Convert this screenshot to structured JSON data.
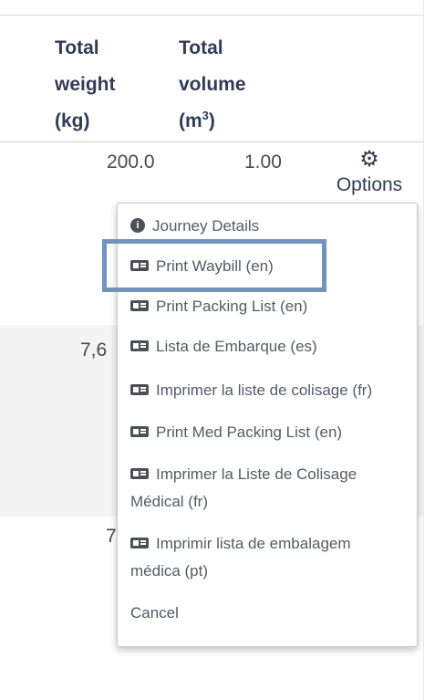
{
  "table": {
    "headers": {
      "weight": [
        "Total",
        "weight",
        "(kg)"
      ],
      "volume": [
        "Total",
        "volume",
        "(m",
        "3",
        ")"
      ]
    },
    "rows": [
      {
        "weight": "200.0",
        "volume": "1.00"
      },
      {
        "weight": "7,6"
      },
      {
        "weight": "7"
      }
    ]
  },
  "options": {
    "icon": "gear-icon",
    "label": "Options"
  },
  "menu": {
    "items": [
      {
        "icon": "info-icon",
        "label": "Journey Details"
      },
      {
        "icon": "id-card-icon",
        "label": "Print Waybill (en)",
        "highlighted": true
      },
      {
        "icon": "id-card-icon",
        "label": "Print Packing List (en)"
      },
      {
        "icon": "id-card-icon",
        "label": "Lista de Embarque (es)"
      },
      {
        "icon": "id-card-icon",
        "label": "Imprimer la liste de colisage (fr)"
      },
      {
        "icon": "id-card-icon",
        "label": "Print Med Packing List (en)"
      },
      {
        "icon": "id-card-icon",
        "label": "Imprimer la Liste de Colisage",
        "label_line2": "Médical (fr)"
      },
      {
        "icon": "id-card-icon",
        "label": "Imprimir lista de embalagem",
        "label_line2": "médica (pt)"
      },
      {
        "label": "Cancel"
      }
    ]
  },
  "colors": {
    "header_text": "#2f3c59",
    "highlight_border": "#6f93c4",
    "striped_row": "#f4f4f4"
  }
}
